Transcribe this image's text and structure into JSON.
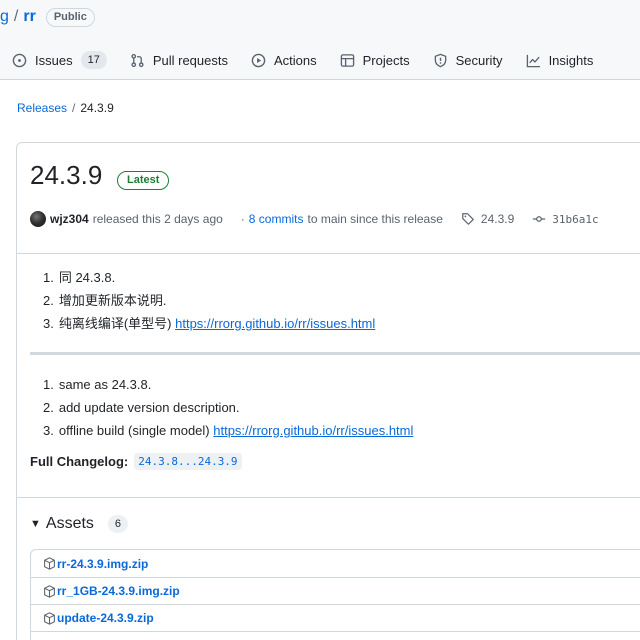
{
  "repo": {
    "owner": "g",
    "slash": "/",
    "name": "rr",
    "visibility": "Public"
  },
  "tabs": [
    {
      "icon": "issue-icon",
      "label": "Issues",
      "count": "17"
    },
    {
      "icon": "pull-request-icon",
      "label": "Pull requests"
    },
    {
      "icon": "play-icon",
      "label": "Actions"
    },
    {
      "icon": "table-icon",
      "label": "Projects"
    },
    {
      "icon": "shield-icon",
      "label": "Security"
    },
    {
      "icon": "graph-icon",
      "label": "Insights"
    }
  ],
  "breadcrumb": {
    "releases": "Releases",
    "sep": "/",
    "current": "24.3.9"
  },
  "release": {
    "title": "24.3.9",
    "badge": "Latest",
    "author": "wjz304",
    "released_text": "released this 2 days ago",
    "commits_prefix": "·",
    "commits_link": "8 commits",
    "commits_suffix": "to main since this release",
    "tag": "24.3.9",
    "sha": "31b6a1c"
  },
  "notes_cn": [
    {
      "num": "1.",
      "text": "同 24.3.8.",
      "link": ""
    },
    {
      "num": "2.",
      "text": "增加更新版本说明.",
      "link": ""
    },
    {
      "num": "3.",
      "text": "纯离线编译(单型号) ",
      "link": "https://rrorg.github.io/rr/issues.html"
    }
  ],
  "notes_en": [
    {
      "num": "1.",
      "text": "same as 24.3.8.",
      "link": ""
    },
    {
      "num": "2.",
      "text": "add update version description.",
      "link": ""
    },
    {
      "num": "3.",
      "text": "offline build (single model) ",
      "link": "https://rrorg.github.io/rr/issues.html"
    }
  ],
  "changelog": {
    "label": "Full Changelog:",
    "range": "24.3.8...24.3.9"
  },
  "assets": {
    "title": "Assets",
    "count": "6",
    "files": [
      "rr-24.3.9.img.zip",
      "rr_1GB-24.3.9.img.zip",
      "update-24.3.9.zip"
    ]
  },
  "colors": {
    "link": "#0969da",
    "latest": "#1a7f37",
    "border": "#d0d7de"
  }
}
